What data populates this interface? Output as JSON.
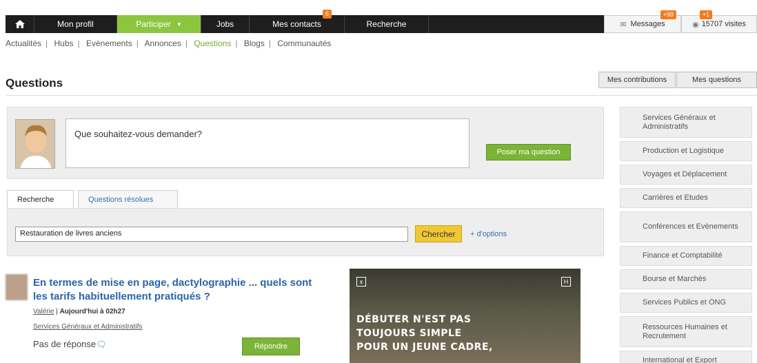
{
  "nav": {
    "home_icon": "home-icon",
    "profil": "Mon profil",
    "participer": "Participer",
    "jobs": "Jobs",
    "contacts": "Mes contacts",
    "contacts_badge": "6",
    "recherche": "Recherche",
    "messages": "Messages",
    "messages_badge": "+99",
    "visites": "15707 visites",
    "visites_badge": "+1"
  },
  "subnav": [
    "Actualités",
    "Hubs",
    "Evènements",
    "Annonces",
    "Questions",
    "Blogs",
    "Communautés"
  ],
  "page": {
    "title": "Questions",
    "btn_contributions": "Mes contributions",
    "btn_questions": "Mes questions"
  },
  "ask": {
    "placeholder": "Que souhaitez-vous demander?",
    "submit": "Poser ma question"
  },
  "tabs": [
    "Recherche",
    "Questions résolues"
  ],
  "search": {
    "value": "Restauration de livres anciens",
    "button": "Chercher",
    "more": "+ d'options"
  },
  "question": {
    "title": "En termes de mise en page, dactylographie ... quels sont les tarifs habituellement pratiqués ?",
    "author": "Valérie",
    "date": "Aujourd'hui à 02h27",
    "category": "Services Généraux et Administratifs",
    "no_answer": "Pas de réponse",
    "reply": "Répondre"
  },
  "ad": {
    "line1": "DÉBUTER N'EST PAS",
    "line2": "TOUJOURS SIMPLE",
    "line3": "POUR UN JEUNE CADRE,",
    "icon_left": "x",
    "icon_right": "H"
  },
  "categories": [
    "Services Généraux et Administratifs",
    "Production et Logistique",
    "Voyages et Déplacement",
    "Carrières et Etudes",
    "Conférences et Evènements",
    "Finance et Comptabilité",
    "Bourse et Marchés",
    "Services Publics et ONG",
    "Ressources Humaines et Recrutement",
    "International et Export"
  ],
  "colors": {
    "accent_green": "#8cc63f",
    "link_blue": "#2b64a8",
    "badge_orange": "#f07c1f",
    "search_yellow": "#f0c834"
  }
}
